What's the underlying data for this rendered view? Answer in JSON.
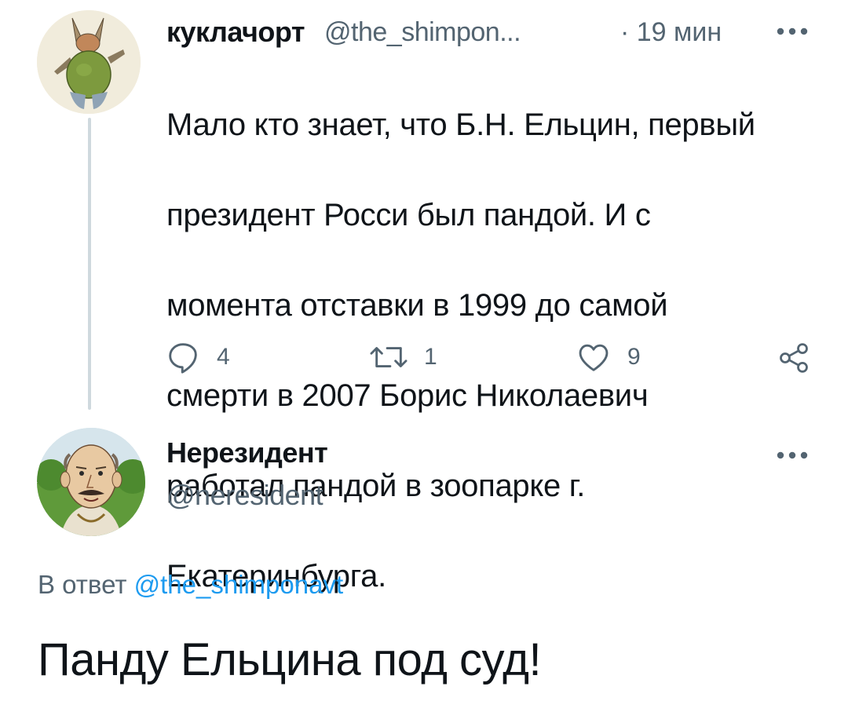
{
  "tweet1": {
    "display_name": "куклачорт",
    "handle": "@the_shimpon...",
    "time": "· 19 мин",
    "text_lines": [
      "Мало кто знает, что Б.Н. Ельцин, первый",
      "президент Росси был пандой. И с",
      "момента отставки в 1999 до самой",
      "смерти в 2007 Борис Николаевич",
      "работал пандой в зоопарке г.",
      "Екатеринбурга."
    ],
    "actions": {
      "reply_count": "4",
      "retweet_count": "1",
      "like_count": "9"
    },
    "icons": [
      "more-icon",
      "reply-icon",
      "retweet-icon",
      "like-icon",
      "share-icon"
    ]
  },
  "tweet2": {
    "display_name": "Нерезидент",
    "handle": "@neresident",
    "reply_prefix": "В ответ ",
    "reply_mention": "@the_shimponavt",
    "text": "Панду Ельцина под суд!"
  },
  "colors": {
    "text": "#0f1419",
    "secondary": "#536471",
    "link": "#1d9bf0",
    "thread_line": "#cfd9de",
    "background": "#ffffff"
  }
}
